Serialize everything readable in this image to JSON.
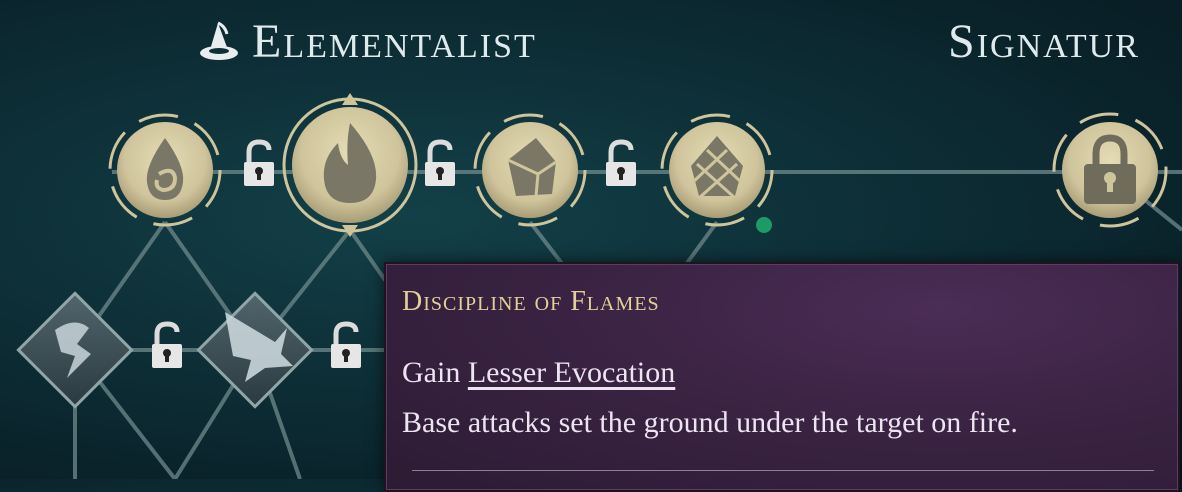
{
  "headers": {
    "elementalist": "Elementalist",
    "signature": "Signatur"
  },
  "tooltip": {
    "title": "Discipline of Flames",
    "gain_prefix": "Gain",
    "gain_link": "Lesser Evocation",
    "description": "Base attacks set the ground under the target on fire."
  },
  "nodes": {
    "top_row": [
      "water-swirl-icon",
      "flame-icon",
      "shard-icon",
      "crystal-icon"
    ],
    "second_row": [
      "lightning-spirit-icon",
      "wolf-spirit-icon"
    ],
    "signature": "padlock-icon"
  },
  "colors": {
    "accent_gold": "#d8cfa6",
    "tooltip_title": "#e3cf9a",
    "active_dot": "#1e9a66"
  }
}
